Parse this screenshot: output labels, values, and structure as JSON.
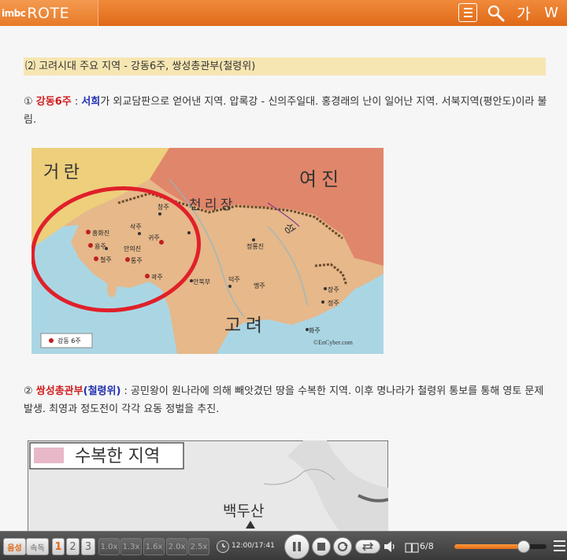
{
  "header": {
    "logo_prefix": "imbc",
    "logo_main": "ROTE",
    "search_glyph": "🔍",
    "font_glyph": "가",
    "bookmark_glyph": "W"
  },
  "section": {
    "title": "⑵ 고려시대 주요 지역 - 강동6주, 쌍성총관부(철령위)"
  },
  "item1": {
    "num": "① ",
    "name": "강동6주",
    "sep": " : ",
    "person": "서희",
    "rest": "가 외교담판으로 얻어낸 지역. 압록강 - 신의주일대. 홍경래의 난이 일어난 지역. 서북지역(평안도)이라 불림."
  },
  "map1": {
    "label_georan": "거 란",
    "label_yeojin": "여 진",
    "label_cheolli": "천 리 장",
    "label_seong": "성",
    "label_goryeo": "고 려",
    "cities": [
      "창주",
      "삭주",
      "흥화진",
      "귀주",
      "용주",
      "안의진",
      "철주",
      "통주",
      "곽주",
      "정룡진",
      "덕주",
      "안북부",
      "맹주",
      "장주",
      "정주",
      "화주"
    ],
    "legend": "강동 6주",
    "copyright": "©EnCyber.com"
  },
  "item2": {
    "num": "② ",
    "name": "쌍성총관부",
    "open": "(",
    "alt": "철령위",
    "close": ")",
    "rest": " : 공민왕이 원나라에 의해 빼앗겼던 땅을 수복한 지역. 이후 명나라가 철령위 통보를 통해 영토 문제 발생. 최영과 정도전이 각각 요동 정벌을 추진."
  },
  "map2": {
    "legend": "수복한 지역",
    "mountain": "백두산"
  },
  "player": {
    "audio": "음성",
    "speed_label": "속독",
    "levels": [
      "1",
      "2",
      "3"
    ],
    "speeds": [
      "1.0x",
      "1.3x",
      "1.6x",
      "2.0x",
      "2.5x"
    ],
    "time": "12:00/17:41",
    "page": "6/8",
    "volume": 0.75
  },
  "colors": {
    "accent": "#e87a28",
    "map_red": "#e0202a"
  }
}
